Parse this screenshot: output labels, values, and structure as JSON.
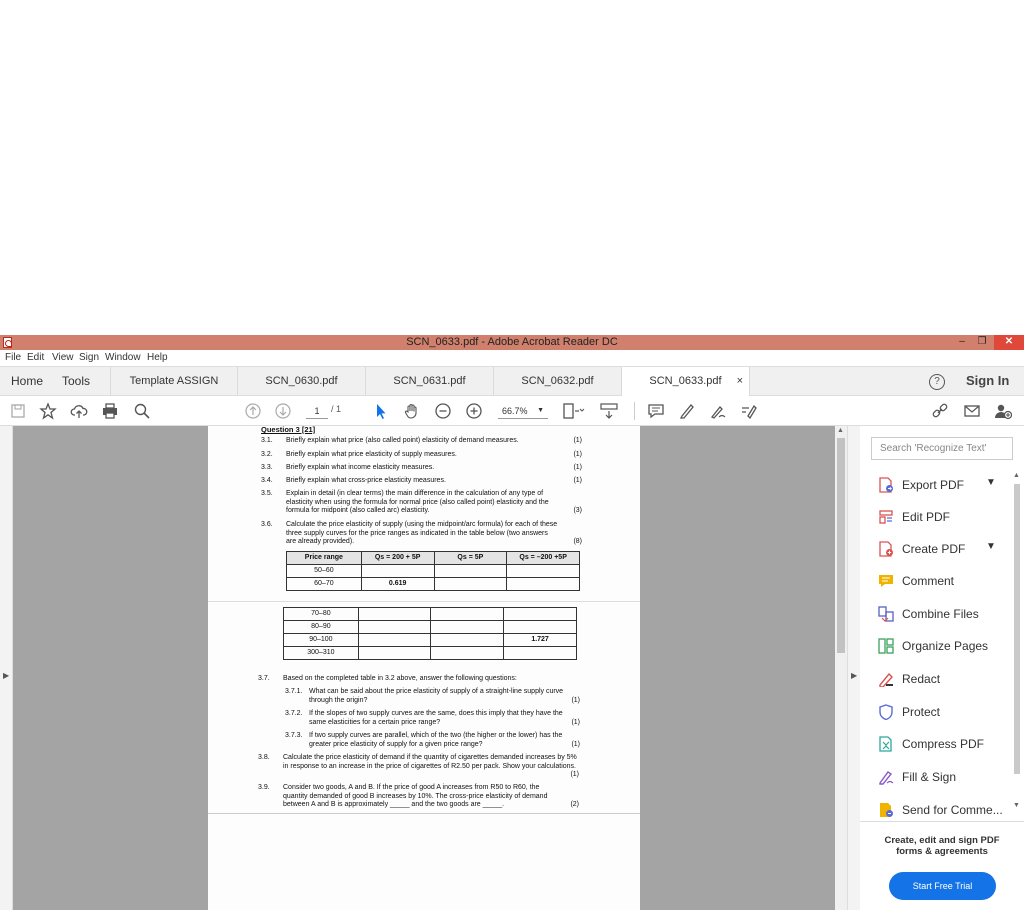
{
  "window": {
    "title": "SCN_0633.pdf - Adobe Acrobat Reader DC",
    "min": "–",
    "max": "❐",
    "close": "✕"
  },
  "menu": {
    "items": [
      "File",
      "Edit",
      "View",
      "Sign",
      "Window",
      "Help"
    ]
  },
  "tabs": {
    "home": "Home",
    "tools": "Tools",
    "docs": [
      "Template ASSIGN",
      "SCN_0630.pdf",
      "SCN_0631.pdf",
      "SCN_0632.pdf",
      "SCN_0633.pdf"
    ],
    "close": "×",
    "help": "?",
    "signin": "Sign In"
  },
  "toolbar": {
    "page_current": "1",
    "page_total": "/ 1",
    "zoom": "66.7%"
  },
  "document": {
    "question_title": "Question 3  [21]",
    "questions": [
      {
        "num": "3.1.",
        "text": "Briefly explain what price (also called point) elasticity of demand measures.",
        "mark": "(1)"
      },
      {
        "num": "3.2.",
        "text": "Briefly explain what price elasticity of supply measures.",
        "mark": "(1)"
      },
      {
        "num": "3.3.",
        "text": "Briefly explain what income elasticity measures.",
        "mark": "(1)"
      },
      {
        "num": "3.4.",
        "text": "Briefly explain what cross-price elasticity measures.",
        "mark": "(1)"
      },
      {
        "num": "3.5.",
        "text": "Explain in detail (in clear terms) the main difference in the calculation of any type of elasticity when using the formula for normal price (also called point) elasticity and the formula for midpoint (also called arc) elasticity.",
        "mark": "(3)"
      },
      {
        "num": "3.6.",
        "text": "Calculate the price elasticity of supply (using the midpoint/arc formula) for each of these three supply curves for the price ranges as indicated in the table below (two answers are already provided).",
        "mark": "(8)"
      }
    ],
    "table_headers": [
      "Price range",
      "Qs = 200 + 5P",
      "Qs = 5P",
      "Qs = –200 +5P"
    ],
    "table_rows_top": [
      [
        "50–60",
        "",
        "",
        ""
      ],
      [
        "60–70",
        "0.619",
        "",
        ""
      ]
    ],
    "table_rows_bottom": [
      [
        "70–80",
        "",
        "",
        ""
      ],
      [
        "80–90",
        "",
        "",
        ""
      ],
      [
        "90–100",
        "",
        "",
        "1.727"
      ],
      [
        "300–310",
        "",
        "",
        ""
      ]
    ],
    "q37": {
      "num": "3.7.",
      "text": "Based on the completed table in 3.2 above, answer the following questions:"
    },
    "q37_subs": [
      {
        "num": "3.7.1.",
        "text": "What can be said about the price elasticity of supply of a straight-line supply curve through the origin?",
        "mark": "(1)"
      },
      {
        "num": "3.7.2.",
        "text": "If the slopes of two supply curves are the same, does this imply that they have the same elasticities for a certain price range?",
        "mark": "(1)"
      },
      {
        "num": "3.7.3.",
        "text": "If two supply curves are parallel, which of the two (the higher or the lower) has the greater price elasticity of supply for a given price range?",
        "mark": "(1)"
      }
    ],
    "q38": {
      "num": "3.8.",
      "text": "Calculate the price elasticity of demand if the quantity of cigarettes demanded increases by 5% in response to an increase in the price of cigarettes of R2.50 per pack. Show your calculations.",
      "mark": "(1)"
    },
    "q39": {
      "num": "3.9.",
      "text": "Consider two goods, A and B. If the price of good A increases from R50 to R60, the quantity demanded of good B increases by 10%. The cross-price elasticity of demand between A and B is approximately _____ and the two goods are _____.",
      "mark": "(2)"
    }
  },
  "right_panel": {
    "search_placeholder": "Search 'Recognize Text'",
    "tools": [
      {
        "label": "Export PDF",
        "icon": "export-pdf-icon",
        "color": "#d9534f",
        "chevron": "⌄"
      },
      {
        "label": "Edit PDF",
        "icon": "edit-pdf-icon",
        "color": "#d9534f"
      },
      {
        "label": "Create PDF",
        "icon": "create-pdf-icon",
        "color": "#d9534f",
        "chevron": "⌄"
      },
      {
        "label": "Comment",
        "icon": "comment-icon",
        "color": "#f0b400"
      },
      {
        "label": "Combine Files",
        "icon": "combine-files-icon",
        "color": "#5b5fc7"
      },
      {
        "label": "Organize Pages",
        "icon": "organize-pages-icon",
        "color": "#3aa15e"
      },
      {
        "label": "Redact",
        "icon": "redact-icon",
        "color": "#d9534f"
      },
      {
        "label": "Protect",
        "icon": "protect-icon",
        "color": "#5b6bd6"
      },
      {
        "label": "Compress PDF",
        "icon": "compress-pdf-icon",
        "color": "#2aa79b"
      },
      {
        "label": "Fill & Sign",
        "icon": "fill-sign-icon",
        "color": "#8a58c8"
      },
      {
        "label": "Send for Comme...",
        "icon": "send-for-comment-icon",
        "color": "#f0b400"
      }
    ],
    "promo": "Create, edit and sign PDF forms & agreements",
    "trial_button": "Start Free Trial"
  }
}
